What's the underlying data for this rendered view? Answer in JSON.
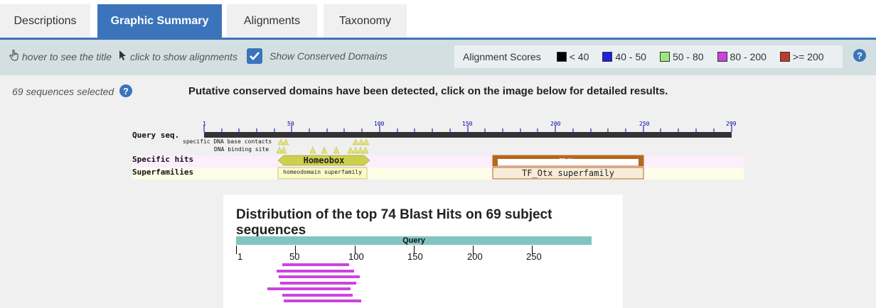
{
  "tabs": [
    {
      "label": "Descriptions",
      "active": false
    },
    {
      "label": "Graphic Summary",
      "active": true
    },
    {
      "label": "Alignments",
      "active": false
    },
    {
      "label": "Taxonomy",
      "active": false
    }
  ],
  "toolbar": {
    "hover_text": "hover to see the title",
    "click_text": "click to show alignments",
    "show_cd_label": "Show Conserved Domains",
    "show_cd_checked": true,
    "legend_title": "Alignment Scores",
    "legend": [
      {
        "label": "< 40",
        "color": "#000000"
      },
      {
        "label": "40 - 50",
        "color": "#2020e0"
      },
      {
        "label": "50 - 80",
        "color": "#9de87a"
      },
      {
        "label": "80 - 200",
        "color": "#cc44dd"
      },
      {
        "label": ">= 200",
        "color": "#c03a2b"
      }
    ],
    "help_glyph": "?"
  },
  "selection": {
    "text": "69 sequences selected",
    "help_glyph": "?"
  },
  "cd_header": "Putative conserved domains have been detected, click on the image below for detailed results.",
  "cdd": {
    "query_label": "Query seq.",
    "ruler": [
      "1",
      "50",
      "100",
      "150",
      "200",
      "250",
      "299"
    ],
    "specific_dna_label": "specific DNA base contacts",
    "dna_binding_label": "DNA binding site",
    "specific_hits_label": "Specific hits",
    "superfamilies_label": "Superfamilies",
    "homeobox_label": "Homeobox",
    "homeodomain_sf_label": "homeodomain superfamily",
    "tf_otx_label": "TF_Otx",
    "tf_otx_sf_label": "TF_Otx superfamily"
  },
  "distribution": {
    "title": "Distribution of the top 74 Blast Hits on 69 subject sequences",
    "query_label": "Query",
    "ticks": [
      "1",
      "50",
      "100",
      "150",
      "200",
      "250"
    ],
    "hits": [
      {
        "start": 40,
        "end": 96
      },
      {
        "start": 35,
        "end": 100
      },
      {
        "start": 37,
        "end": 105
      },
      {
        "start": 38,
        "end": 102
      },
      {
        "start": 27,
        "end": 97
      },
      {
        "start": 40,
        "end": 99
      },
      {
        "start": 41,
        "end": 106
      }
    ]
  }
}
